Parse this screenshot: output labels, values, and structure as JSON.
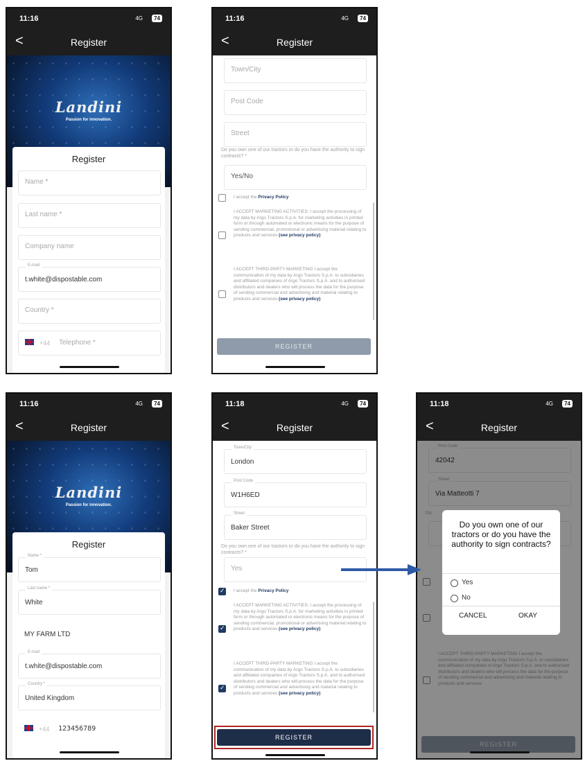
{
  "status": {
    "time1": "11:16",
    "time2": "11:18",
    "network": "4G",
    "battery": "74"
  },
  "nav": {
    "title": "Register",
    "back": "<"
  },
  "brand": {
    "logo": "Landini",
    "tagline": "Passion for innovation."
  },
  "card": {
    "title": "Register"
  },
  "phone1": {
    "fields": [
      {
        "label": "Name *",
        "value": ""
      },
      {
        "label": "Last name *",
        "value": ""
      },
      {
        "label": "Company name",
        "value": ""
      },
      {
        "label": "E-mail",
        "value": "t.white@dispostable.com"
      },
      {
        "label": "Country *",
        "value": ""
      }
    ],
    "telephone": {
      "prefix": "+44",
      "placeholder": "Telephone *"
    }
  },
  "phone2": {
    "fields": [
      "Town/City",
      "Post Code",
      "Street"
    ],
    "question": "Do you own one of our tractors or do you have the authority to sign contracts? *",
    "yesno": "Yes/No",
    "privacy": {
      "text": "I accept the",
      "link": "Privacy Policy"
    },
    "marketing": {
      "text": "I ACCEPT MARKETING ACTIVITIES: I accept the processing of my data by Argo Tractors S.p.A. for marketing activities in printed form or through automated or electronic means for the purpose of sending commercial, promotional or advertising material relating to products and services",
      "link": "(see privacy policy)"
    },
    "third_party": {
      "text": "I ACCEPT THIRD-PARTY MARKETING I accept the communication of my data by Argo Tractors S.p.A. to subsidiaries and affiliated companies of Argo Tractors S.p.A. and to authorised distributors and dealers who will process the data for the purpose of sending commercial and advertising and material relating to products and services",
      "link": "(see privacy policy)"
    },
    "register_button": "REGISTER"
  },
  "phone3": {
    "fields": [
      {
        "label": "Name *",
        "value": "Tom"
      },
      {
        "label": "Last name *",
        "value": "White"
      },
      {
        "label": "",
        "value": "MY FARM LTD"
      },
      {
        "label": "E-mail",
        "value": "t.white@dispostable.com"
      },
      {
        "label": "Country *",
        "value": "United Kingdom"
      }
    ],
    "telephone": {
      "prefix": "+44",
      "value": "123456789"
    }
  },
  "phone4": {
    "fields": [
      {
        "label": "Town/City",
        "value": "London"
      },
      {
        "label": "Post Code",
        "value": "W1H6ED"
      },
      {
        "label": "Street",
        "value": "Baker Street"
      }
    ],
    "answer": "Yes"
  },
  "phone5": {
    "fields": [
      {
        "label": "Post Code",
        "value": "42042"
      },
      {
        "label": "Street",
        "value": "Via Matteotti 7"
      }
    ],
    "question_fragment": "Do",
    "third_party_fragment": "I ACCEPT THIRD-PARTY MARKETING I accept the communication of my data by Argo Tractors S.p.A. to subsidiaries and affiliated companies of Argo Tractors S.p.A. and to authorised distributors and dealers who will process the data for the purpose of sending commercial and advertising and material relating to products and services",
    "dialog": {
      "question": "Do you own one of our tractors or do you have the authority to sign contracts?",
      "options": [
        "Yes",
        "No"
      ],
      "cancel": "CANCEL",
      "ok": "OKAY"
    }
  },
  "colors": {
    "dark_bar": "#1e1e1e",
    "navy": "#1e2d48",
    "disabled_button": "#8f9baa",
    "highlight": "#b02424",
    "arrow": "#2e5aa8"
  }
}
